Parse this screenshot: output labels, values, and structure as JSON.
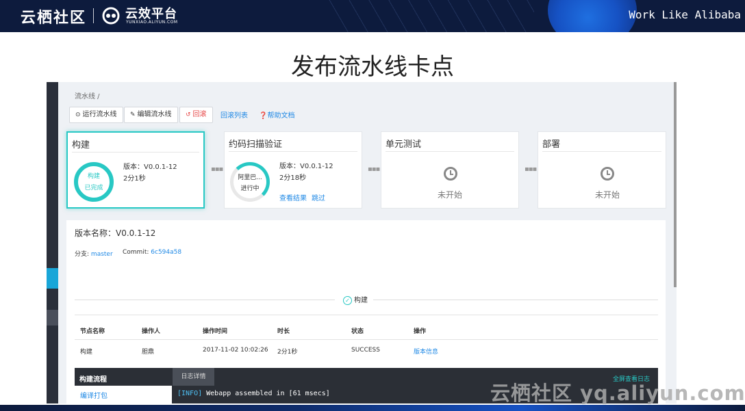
{
  "banner": {
    "brand1": "云栖社区",
    "brand2": "云效平台",
    "brand2_sub": "YUNXIAO.ALIYUN.COM",
    "slogan": "Work Like Alibaba"
  },
  "slide_title": "发布流水线卡点",
  "app": {
    "breadcrumb": "流水线  /",
    "toolbar": {
      "run": "运行流水线",
      "edit": "编辑流水线",
      "rollback": "回滚",
      "rollback_list": "回滚列表",
      "help": "帮助文档"
    },
    "stages": [
      {
        "title": "构建",
        "ring_top": "构建",
        "ring_bottom": "已完成",
        "version": "版本：V0.0.1-12",
        "duration": "2分1秒"
      },
      {
        "title": "约码扫描验证",
        "ring_top": "阿里巴...",
        "ring_bottom": "进行中",
        "version": "版本：V0.0.1-12",
        "duration": "2分18秒",
        "link1": "查看结果",
        "link2": "跳过"
      },
      {
        "title": "单元测试",
        "status": "未开始"
      },
      {
        "title": "部署",
        "status": "未开始"
      }
    ],
    "detail": {
      "version_name": "版本名称：V0.0.1-12",
      "branch_label": "分支:",
      "branch": "master",
      "commit_label": "Commit:",
      "commit": "6c594a58",
      "section": "构建",
      "columns": [
        "节点名称",
        "操作人",
        "操作时间",
        "时长",
        "状态",
        "操作"
      ],
      "row": [
        "构建",
        "胆鼎",
        "2017-11-02 10:02:26",
        "2分1秒",
        "SUCCESS",
        "版本信息"
      ]
    },
    "log": {
      "title": "构建流程",
      "tab": "日志详情",
      "fullscreen": "全屏查看日志",
      "step": "编译打包",
      "level": "[INFO]",
      "message": " Webapp assembled in [61 msecs]"
    }
  },
  "watermark": "云栖社区 yq.aliyun.com",
  "colors": {
    "accent": "#28c8c4",
    "link": "#1e88e5",
    "banner": "#0d1b3d",
    "danger": "#e64545"
  }
}
